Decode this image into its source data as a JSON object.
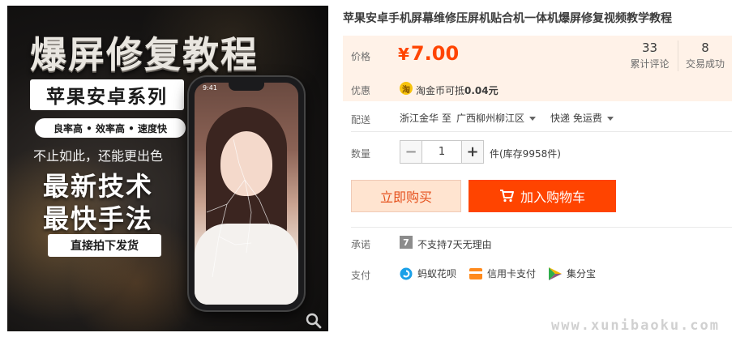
{
  "promo_image": {
    "headline": "爆屏修复教程",
    "series": "苹果安卓系列",
    "tags": "良率高 • 效率高 • 速度快",
    "not_only": "不止如此，还能更出色",
    "big_line1": "最新技术",
    "big_line2": "最快手法",
    "cta": "直接拍下发货",
    "phone_time": "9:41"
  },
  "product": {
    "title": "苹果安卓手机屏幕维修压屏机贴合机一体机爆屏修复视频教学教程"
  },
  "price": {
    "label": "价格",
    "currency": "¥",
    "value": "7.00",
    "accent_color": "#ff4400"
  },
  "stats": [
    {
      "value": "33",
      "label": "累计评论"
    },
    {
      "value": "8",
      "label": "交易成功"
    }
  ],
  "promotion": {
    "label": "优惠",
    "coin_glyph": "淘",
    "text_prefix": "淘金币可抵",
    "amount": "0.04元"
  },
  "shipping": {
    "label": "配送",
    "from": "浙江金华 至",
    "to": "广西柳州柳江区",
    "method": "快递 免运费"
  },
  "quantity": {
    "label": "数量",
    "minus": "−",
    "value": "1",
    "plus": "+",
    "stock": "件(库存9958件)"
  },
  "actions": {
    "buy_now": "立即购买",
    "add_to_cart": "加入购物车"
  },
  "promise": {
    "label": "承诺",
    "icon_glyph": "7",
    "text": "不支持7天无理由"
  },
  "payment": {
    "label": "支付",
    "methods": [
      {
        "name": "蚂蚁花呗",
        "icon": "huabei-icon"
      },
      {
        "name": "信用卡支付",
        "icon": "credit-card-icon"
      },
      {
        "name": "集分宝",
        "icon": "jifenbao-icon"
      }
    ]
  },
  "watermark": "www.xunibaoku.com"
}
